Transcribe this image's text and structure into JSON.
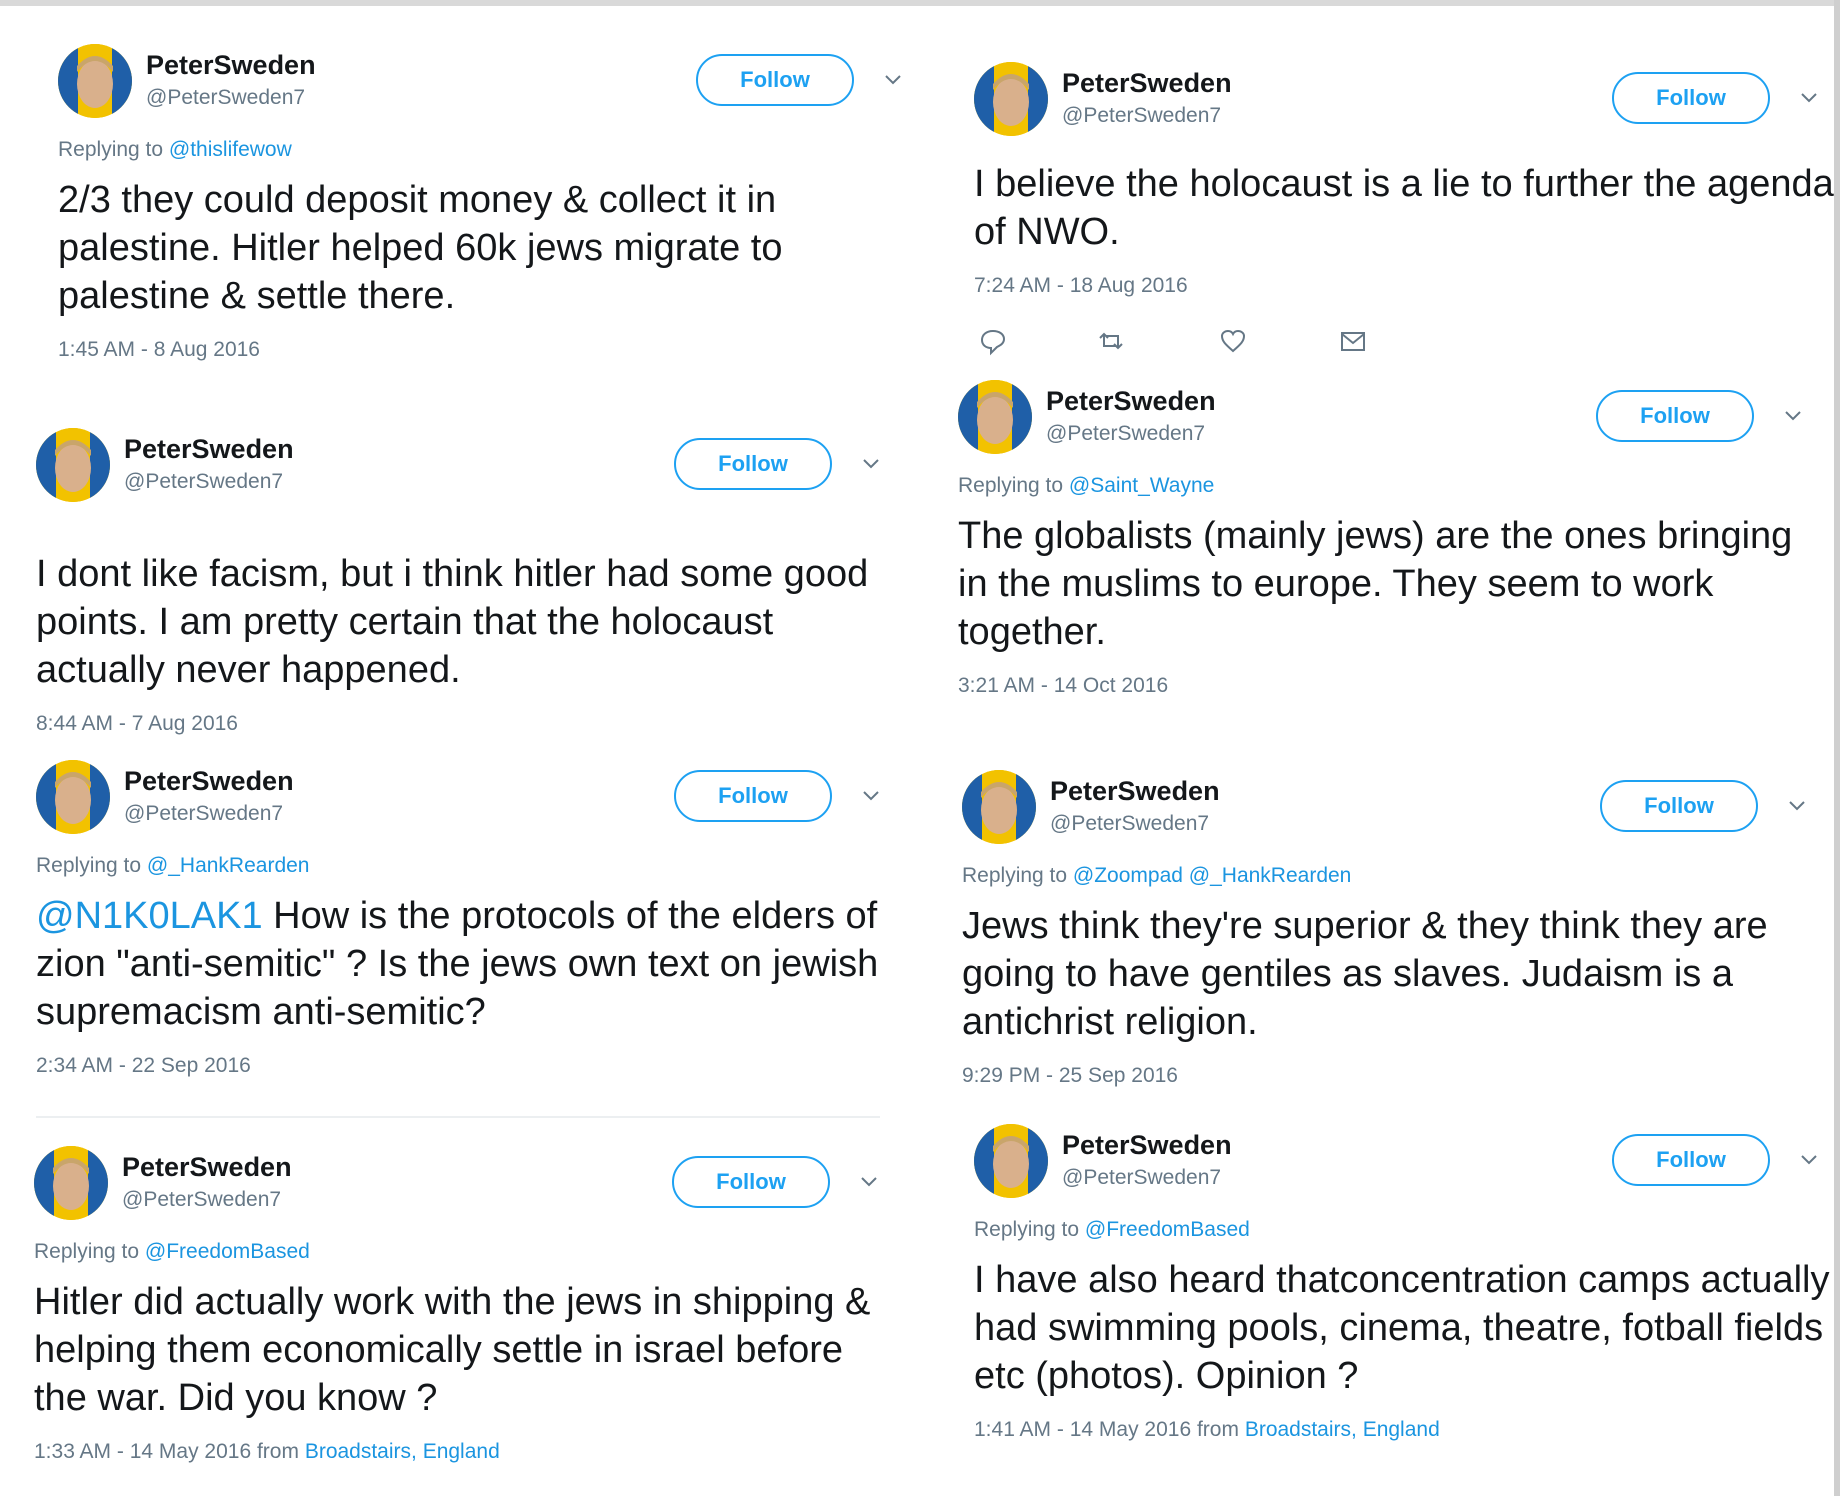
{
  "colors": {
    "accent": "#1da1f2",
    "link": "#1b95e0",
    "muted": "#657786",
    "text": "#14171a"
  },
  "icons": {
    "caret": "chevron-down-icon",
    "reply": "reply-icon",
    "retweet": "retweet-icon",
    "like": "heart-icon",
    "dm": "envelope-icon"
  },
  "tweets": [
    {
      "name": "PeterSweden",
      "handle": "@PeterSweden7",
      "follow": "Follow",
      "reply_prefix": "Replying to ",
      "reply_to": "@thislifewow",
      "mention": "",
      "text": "2/3 they could deposit money & collect it in palestine. Hitler helped 60k jews migrate to palestine & settle there.",
      "time": "1:45 AM - 8 Aug 2016",
      "from_prefix": "",
      "from": ""
    },
    {
      "name": "PeterSweden",
      "handle": "@PeterSweden7",
      "follow": "Follow",
      "reply_prefix": "",
      "reply_to": "",
      "mention": "",
      "text": "I dont like facism, but i think hitler had some good points. I am pretty certain that the holocaust actually never happened.",
      "time": "8:44 AM - 7 Aug 2016",
      "from_prefix": "",
      "from": ""
    },
    {
      "name": "PeterSweden",
      "handle": "@PeterSweden7",
      "follow": "Follow",
      "reply_prefix": "Replying to ",
      "reply_to": "@_HankRearden",
      "mention": "@N1K0LAK1",
      "text": " How is the protocols of the elders of zion \"anti-semitic\" ? Is the jews own text on jewish supremacism anti-semitic?",
      "time": "2:34 AM - 22 Sep 2016",
      "from_prefix": "",
      "from": ""
    },
    {
      "name": "PeterSweden",
      "handle": "@PeterSweden7",
      "follow": "Follow",
      "reply_prefix": "Replying to ",
      "reply_to": "@FreedomBased",
      "mention": "",
      "text": "Hitler did actually work with the jews in shipping & helping them economically settle in israel before the war. Did you know ?",
      "time": "1:33 AM - 14 May 2016",
      "from_prefix": " from ",
      "from": "Broadstairs, England"
    },
    {
      "name": "PeterSweden",
      "handle": "@PeterSweden7",
      "follow": "Follow",
      "reply_prefix": "",
      "reply_to": "",
      "mention": "",
      "text": "I believe the holocaust is a lie to further the agenda of NWO.",
      "time": "7:24 AM - 18 Aug 2016",
      "from_prefix": "",
      "from": ""
    },
    {
      "name": "PeterSweden",
      "handle": "@PeterSweden7",
      "follow": "Follow",
      "reply_prefix": "Replying to ",
      "reply_to": "@Saint_Wayne",
      "mention": "",
      "text": "The globalists (mainly jews) are the ones bringing in the muslims to europe. They seem to work together.",
      "time": "3:21 AM - 14 Oct 2016",
      "from_prefix": "",
      "from": ""
    },
    {
      "name": "PeterSweden",
      "handle": "@PeterSweden7",
      "follow": "Follow",
      "reply_prefix": "Replying to ",
      "reply_to": "@Zoompad @_HankRearden",
      "mention": "",
      "text": "Jews think they're superior & they think they are going to have gentiles as slaves. Judaism is a antichrist religion.",
      "time": "9:29 PM - 25 Sep 2016",
      "from_prefix": "",
      "from": ""
    },
    {
      "name": "PeterSweden",
      "handle": "@PeterSweden7",
      "follow": "Follow",
      "reply_prefix": "Replying to ",
      "reply_to": "@FreedomBased",
      "mention": "",
      "text": "I have also heard thatconcentration camps actually had swimming pools, cinema, theatre, fotball fields etc (photos). Opinion ?",
      "time": "1:41 AM - 14 May 2016",
      "from_prefix": " from ",
      "from": "Broadstairs, England"
    }
  ]
}
